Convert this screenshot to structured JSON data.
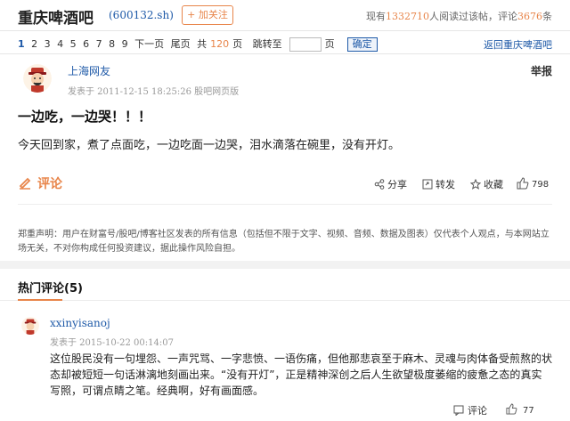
{
  "header": {
    "title": "重庆啤酒吧",
    "code": "(600132.sh)",
    "follow": "+ 加关注",
    "stats_prefix": "现有",
    "readers": "1332710",
    "stats_mid": "人阅读过该帖，评论",
    "comments": "3676",
    "stats_suffix": "条"
  },
  "pager": {
    "pages": [
      "1",
      "2",
      "3",
      "4",
      "5",
      "6",
      "7",
      "8",
      "9"
    ],
    "next": "下一页",
    "last": "尾页",
    "total_prefix": "共",
    "total": "120",
    "total_suffix": "页",
    "jump": "跳转至",
    "jump_suffix": "页",
    "confirm": "确定",
    "back": "返回重庆啤酒吧"
  },
  "post": {
    "author": "上海网友",
    "report": "举报",
    "time": "发表于 2011-12-15 18:25:26 股吧网页版",
    "title": "一边吃，一边哭！！！",
    "body": "今天回到家，煮了点面吃，一边吃面一边哭，泪水滴落在碗里，没有开灯。",
    "comment_label": "评论",
    "share": "分享",
    "forward": "转发",
    "collect": "收藏",
    "likes": "798"
  },
  "disclaimer": "郑重声明：用户在财富号/股吧/博客社区发表的所有信息（包括但不限于文字、视频、音频、数据及图表）仅代表个人观点，与本网站立场无关，不对你构成任何投资建议，据此操作风险自担。",
  "hot": {
    "title": "热门评论",
    "count": "(5)",
    "items": [
      {
        "user": "xxinyisanoj",
        "time": "发表于 2015-10-22 00:14:07",
        "body": "这位股民没有一句埋怨、一声咒骂、一字悲愤、一语伤痛，但他那悲哀至于麻木、灵魂与肉体备受煎熬的状态却被短短一句话淋漓地刻画出来。“没有开灯”，正是精神深创之后人生欲望极度萎缩的疲惫之态的真实写照，可谓点睛之笔。经典啊，好有画面感。",
        "comment": "评论",
        "likes": "77"
      }
    ]
  },
  "colors": {
    "accent": "#e8854a",
    "link": "#1f5aa8"
  },
  "icons": [
    "avatar-caishen-icon",
    "pen-icon",
    "share-icon",
    "forward-icon",
    "star-icon",
    "thumb-up-icon",
    "comment-icon"
  ]
}
